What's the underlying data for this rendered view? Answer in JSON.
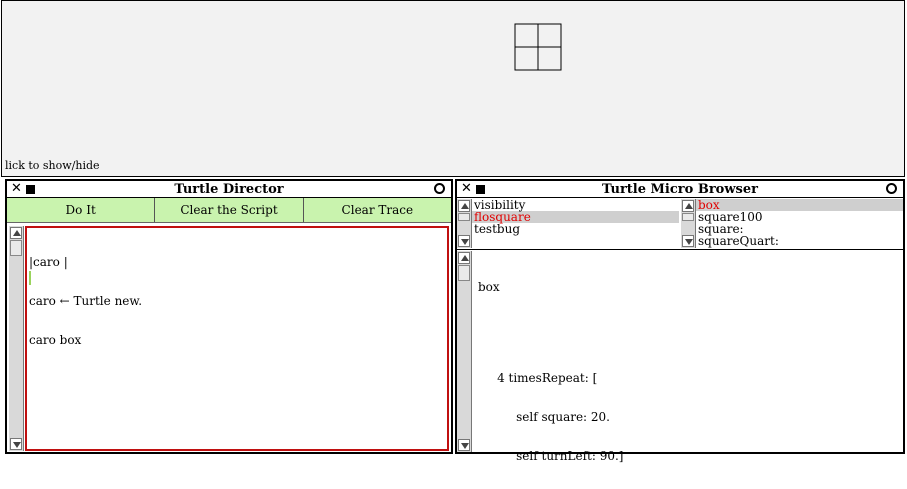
{
  "world": {
    "hint_text": "lick to show/hide"
  },
  "director": {
    "title": "Turtle Director",
    "buttons": [
      "Do It",
      "Clear the Script",
      "Clear Trace"
    ],
    "script_lines": [
      "|caro |",
      "caro ← Turtle new.",
      "caro box"
    ]
  },
  "browser": {
    "title": "Turtle Micro Browser",
    "categories": [
      "visibility",
      "flosquare",
      "testbug"
    ],
    "methods": [
      "box",
      "square100",
      "square:",
      "squareQuart:"
    ],
    "code_lines": [
      "box",
      "",
      "",
      "     4 timesRepeat: [",
      "          self square: 20.",
      "          self turnLeft: 90.]"
    ]
  },
  "colors": {
    "canvas_bg": "#f2f2f2",
    "button_bg": "#c9f3ae",
    "accent_red": "#e00000"
  }
}
